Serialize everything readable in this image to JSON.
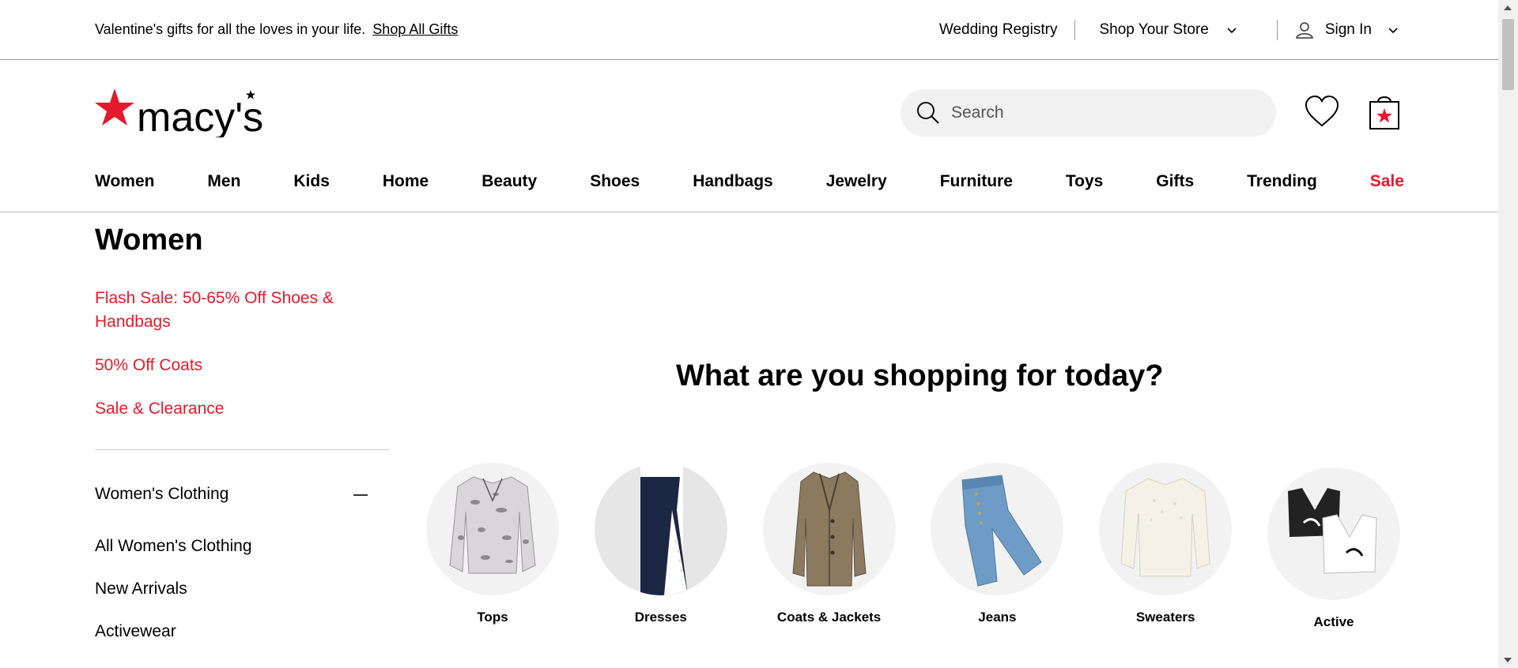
{
  "promo": {
    "text": "Valentine's gifts for all the loves in your life.",
    "link": "Shop All Gifts"
  },
  "utility": {
    "registry": "Wedding Registry",
    "store": "Shop Your Store",
    "signin": "Sign In"
  },
  "brand": {
    "name": "macy's",
    "accent": "#e21a2c"
  },
  "search": {
    "placeholder": "Search"
  },
  "nav": [
    "Women",
    "Men",
    "Kids",
    "Home",
    "Beauty",
    "Shoes",
    "Handbags",
    "Jewelry",
    "Furniture",
    "Toys",
    "Gifts",
    "Trending",
    "Sale"
  ],
  "sidebar": {
    "title": "Women",
    "promos": [
      "Flash Sale: 50-65% Off Shoes & Handbags",
      "50% Off Coats",
      "Sale & Clearance"
    ],
    "category": "Women's Clothing",
    "links": [
      "All Women's Clothing",
      "New Arrivals",
      "Activewear"
    ]
  },
  "main": {
    "headline": "What are you shopping for today?",
    "categories": [
      "Tops",
      "Dresses",
      "Coats & Jackets",
      "Jeans",
      "Sweaters",
      "Active"
    ]
  }
}
